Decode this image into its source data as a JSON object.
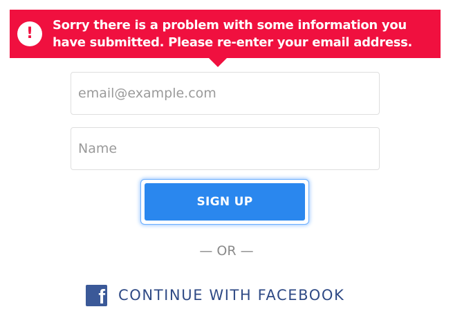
{
  "error": {
    "icon": "exclamation-icon",
    "icon_glyph": "!",
    "message": "Sorry there is a problem with some information you have submitted. Please re-enter your email address."
  },
  "form": {
    "email_placeholder": "email@example.com",
    "email_value": "",
    "name_placeholder": "Name",
    "name_value": "",
    "signup_label": "SIGN UP"
  },
  "divider": {
    "label": "— OR —"
  },
  "facebook": {
    "icon": "facebook-icon",
    "icon_glyph": "f",
    "label": "CONTINUE WITH FACEBOOK"
  },
  "colors": {
    "error_red": "#f0103f",
    "button_blue": "#2a87ee",
    "facebook_blue": "#3b5998",
    "facebook_text": "#2f4a85"
  }
}
